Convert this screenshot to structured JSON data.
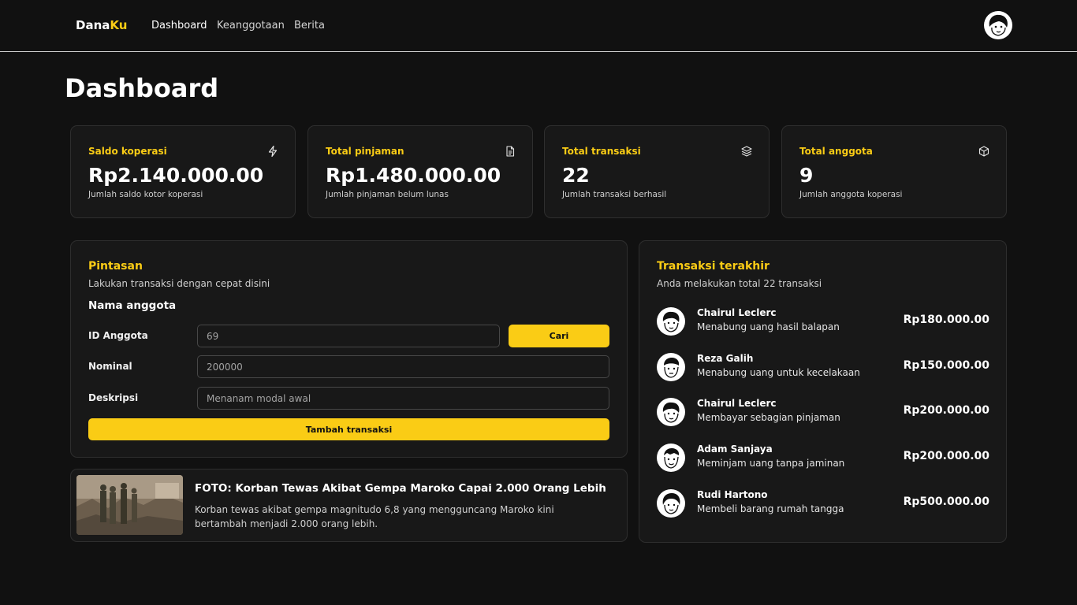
{
  "brand": {
    "part1": "Dana",
    "part2": "Ku"
  },
  "nav": {
    "links": [
      "Dashboard",
      "Keanggotaan",
      "Berita"
    ]
  },
  "page": {
    "title": "Dashboard"
  },
  "stats": [
    {
      "label": "Saldo koperasi",
      "value": "Rp2.140.000.00",
      "sub": "Jumlah saldo kotor koperasi",
      "icon": "lightning-icon"
    },
    {
      "label": "Total pinjaman",
      "value": "Rp1.480.000.00",
      "sub": "Jumlah pinjaman belum lunas",
      "icon": "document-icon"
    },
    {
      "label": "Total transaksi",
      "value": "22",
      "sub": "Jumlah transaksi berhasil",
      "icon": "layers-icon"
    },
    {
      "label": "Total anggota",
      "value": "9",
      "sub": "Jumlah anggota koperasi",
      "icon": "box-icon"
    }
  ],
  "shortcut": {
    "title": "Pintasan",
    "subtitle": "Lakukan transaksi dengan cepat disini",
    "form_heading": "Nama anggota",
    "id_label": "ID Anggota",
    "id_placeholder": "69",
    "search_label": "Cari",
    "nominal_label": "Nominal",
    "nominal_placeholder": "200000",
    "desc_label": "Deskripsi",
    "desc_placeholder": "Menanam modal awal",
    "submit_label": "Tambah transaksi"
  },
  "news": {
    "title": "FOTO: Korban Tewas Akibat Gempa Maroko Capai 2.000 Orang Lebih",
    "description": "Korban tewas akibat gempa magnitudo 6,8 yang mengguncang Maroko kini bertambah menjadi 2.000 orang lebih."
  },
  "transactions": {
    "title": "Transaksi terakhir",
    "subtitle": "Anda melakukan total 22 transaksi",
    "items": [
      {
        "name": "Chairul Leclerc",
        "description": "Menabung uang hasil balapan",
        "amount": "Rp180.000.00"
      },
      {
        "name": "Reza Galih",
        "description": "Menabung uang untuk kecelakaan",
        "amount": "Rp150.000.00"
      },
      {
        "name": "Chairul Leclerc",
        "description": "Membayar sebagian pinjaman",
        "amount": "Rp200.000.00"
      },
      {
        "name": "Adam Sanjaya",
        "description": "Meminjam uang tanpa jaminan",
        "amount": "Rp200.000.00"
      },
      {
        "name": "Rudi Hartono",
        "description": "Membeli barang rumah tangga",
        "amount": "Rp500.000.00"
      }
    ]
  },
  "colors": {
    "accent": "#facc15",
    "background": "#111111",
    "card": "#181818",
    "border": "#2e2e2e"
  }
}
